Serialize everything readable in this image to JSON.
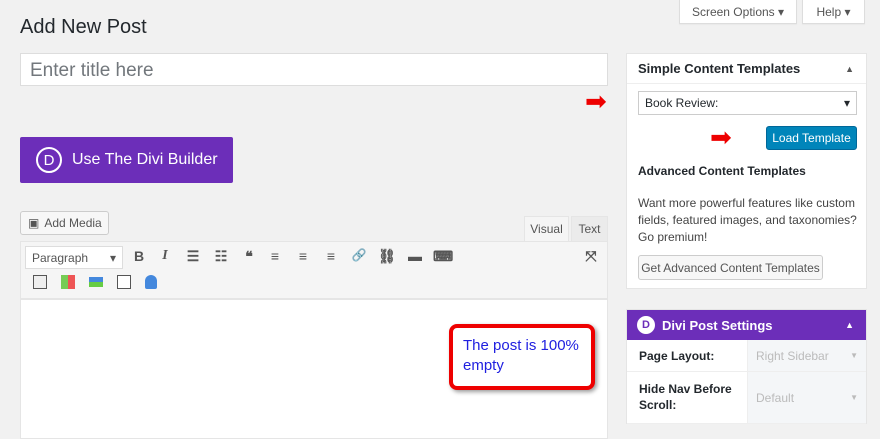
{
  "header": {
    "screen_options": "Screen Options ▾",
    "help": "Help ▾",
    "page_title": "Add New Post"
  },
  "title_placeholder": "Enter title here",
  "divi_builder": {
    "icon": "D",
    "label": "Use The Divi Builder"
  },
  "editor": {
    "add_media": "Add Media",
    "tab_visual": "Visual",
    "tab_text": "Text",
    "format": "Paragraph",
    "icons": [
      "B",
      "I",
      "☰",
      "☷",
      "❝",
      "≡",
      "≡",
      "≡",
      "🔗",
      "⛓",
      "▬",
      "⌨"
    ]
  },
  "callout": "The post is 100% empty",
  "templates": {
    "title": "Simple Content Templates",
    "selected": "Book Review:",
    "load": "Load Template",
    "advanced_title": "Advanced Content Templates",
    "advanced_text": "Want more powerful features like custom fields, featured images, and taxonomies? Go premium!",
    "get_button": "Get Advanced Content Templates"
  },
  "divi_settings": {
    "icon": "D",
    "title": "Divi Post Settings",
    "rows": [
      {
        "label": "Page Layout:",
        "value": "Right Sidebar"
      },
      {
        "label": "Hide Nav Before Scroll:",
        "value": "Default"
      }
    ]
  }
}
